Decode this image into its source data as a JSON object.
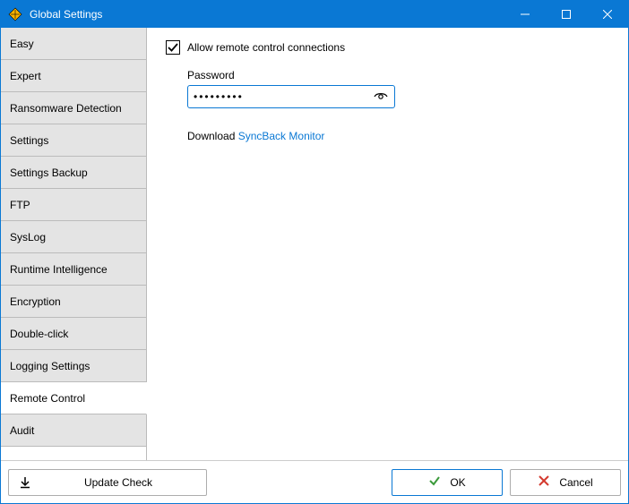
{
  "window": {
    "title": "Global Settings"
  },
  "sidebar": {
    "items": [
      {
        "label": "Easy"
      },
      {
        "label": "Expert"
      },
      {
        "label": "Ransomware Detection"
      },
      {
        "label": "Settings"
      },
      {
        "label": "Settings Backup"
      },
      {
        "label": "FTP"
      },
      {
        "label": "SysLog"
      },
      {
        "label": "Runtime Intelligence"
      },
      {
        "label": "Encryption"
      },
      {
        "label": "Double-click"
      },
      {
        "label": "Logging Settings"
      },
      {
        "label": "Remote Control"
      },
      {
        "label": "Audit"
      }
    ],
    "selected_index": 11
  },
  "content": {
    "allow_remote_label": "Allow remote control connections",
    "allow_remote_checked": true,
    "password_label": "Password",
    "password_value": "•••••••••",
    "download_prefix": "Download ",
    "download_link": "SyncBack Monitor"
  },
  "footer": {
    "update_label": "Update Check",
    "ok_label": "OK",
    "cancel_label": "Cancel"
  }
}
